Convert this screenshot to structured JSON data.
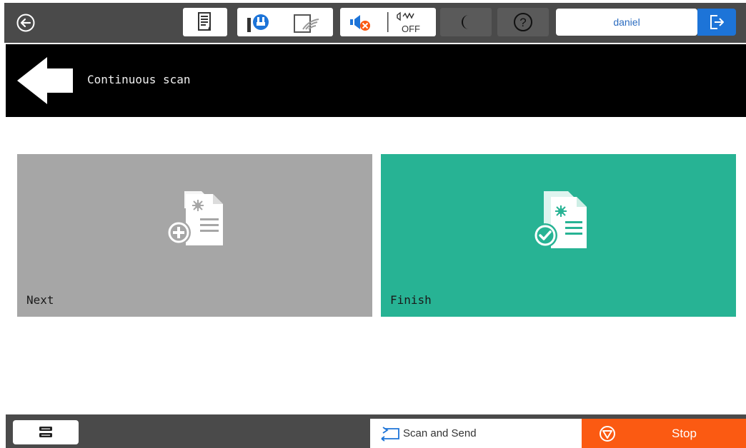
{
  "status_bar": {
    "home_icon": "back-circle-icon",
    "icons": [
      "ink-status-icon",
      "wifi-direct-icon",
      "wifi-icon",
      "mute-icon",
      "silent-off-icon",
      "sleep-icon",
      "help-icon"
    ],
    "silent_label": "OFF",
    "user_name": "daniel",
    "logout_icon": "logout-icon"
  },
  "title_bar": {
    "title": "Continuous scan",
    "back_icon": "back-arrow-icon"
  },
  "tiles": {
    "next": {
      "label": "Next",
      "color": "#a6a6a6",
      "icon": "add-page-icon"
    },
    "finish": {
      "label": "Finish",
      "color": "#27b394",
      "icon": "finish-page-icon"
    }
  },
  "bottom_bar": {
    "menu_icon": "job-list-icon",
    "current_job": "Scan and Send",
    "stop_label": "Stop",
    "stop_color": "#fb5a12"
  }
}
